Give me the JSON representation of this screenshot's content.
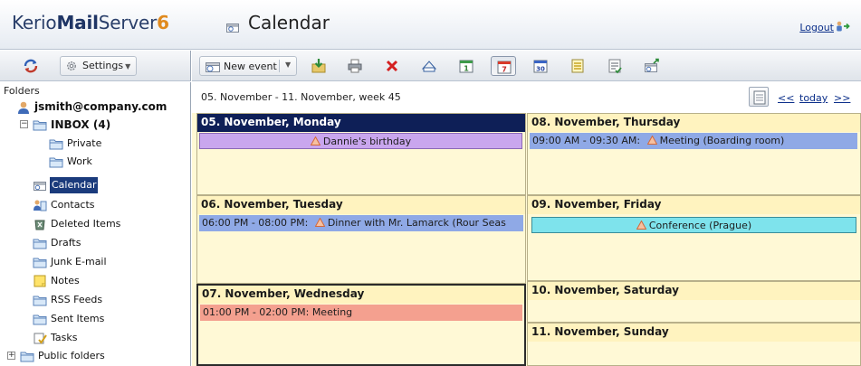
{
  "app": {
    "logo_kerio": "Kerio",
    "logo_mail": "Mail",
    "logo_server": "Server",
    "logo_version": "6",
    "page_title": "Calendar",
    "logout_label": "Logout"
  },
  "left_toolbar": {
    "refresh_icon": "refresh-icon",
    "settings_label": "Settings"
  },
  "toolbar": {
    "new_event_label": "New event",
    "icons": [
      "import-icon",
      "print-icon",
      "delete-icon",
      "go-to-icon",
      "day-view-icon",
      "week-view-icon",
      "month-view-icon",
      "list-view-icon",
      "tasks-icon",
      "calendar-share-icon"
    ]
  },
  "folders": {
    "title": "Folders",
    "account": "jsmith@company.com",
    "items": [
      {
        "label": "INBOX (4)",
        "icon": "folder-icon"
      },
      {
        "label": "Private",
        "icon": "folder-icon"
      },
      {
        "label": "Work",
        "icon": "folder-icon"
      },
      {
        "label": "Calendar",
        "icon": "calendar-icon"
      },
      {
        "label": "Contacts",
        "icon": "contacts-icon"
      },
      {
        "label": "Deleted Items",
        "icon": "deleted-icon"
      },
      {
        "label": "Drafts",
        "icon": "folder-icon"
      },
      {
        "label": "Junk E-mail",
        "icon": "folder-icon"
      },
      {
        "label": "Notes",
        "icon": "notes-icon"
      },
      {
        "label": "RSS Feeds",
        "icon": "folder-icon"
      },
      {
        "label": "Sent Items",
        "icon": "folder-icon"
      },
      {
        "label": "Tasks",
        "icon": "tasks-icon"
      },
      {
        "label": "Public folders",
        "icon": "folder-icon"
      }
    ]
  },
  "calendar": {
    "week_label": "05. November - 11. November, week 45",
    "prev_label": "<<",
    "today_label": "today",
    "next_label": ">>",
    "days": [
      {
        "title": "05. November, Monday",
        "events": [
          {
            "time": "",
            "text": "Dannie's birthday",
            "color": "#c9a6ee"
          }
        ]
      },
      {
        "title": "06. November, Tuesday",
        "events": [
          {
            "time": "06:00 PM - 08:00 PM:",
            "text": "Dinner with Mr. Lamarck (Rour Seas",
            "color": "#8fa9e6"
          }
        ]
      },
      {
        "title": "07. November, Wednesday",
        "events": [
          {
            "time": "01:00 PM - 02:00 PM:",
            "text": "Meeting",
            "color": "#f4a08f"
          }
        ]
      },
      {
        "title": "08. November, Thursday",
        "events": [
          {
            "time": "09:00 AM - 09:30 AM:",
            "text": "Meeting (Boarding room)",
            "color": "#8fa9e6"
          }
        ]
      },
      {
        "title": "09. November, Friday",
        "events": [
          {
            "time": "",
            "text": "Conference (Prague)",
            "color": "#7ee3ec"
          }
        ]
      },
      {
        "title": "10. November, Saturday",
        "events": []
      },
      {
        "title": "11. November, Sunday",
        "events": []
      }
    ]
  }
}
